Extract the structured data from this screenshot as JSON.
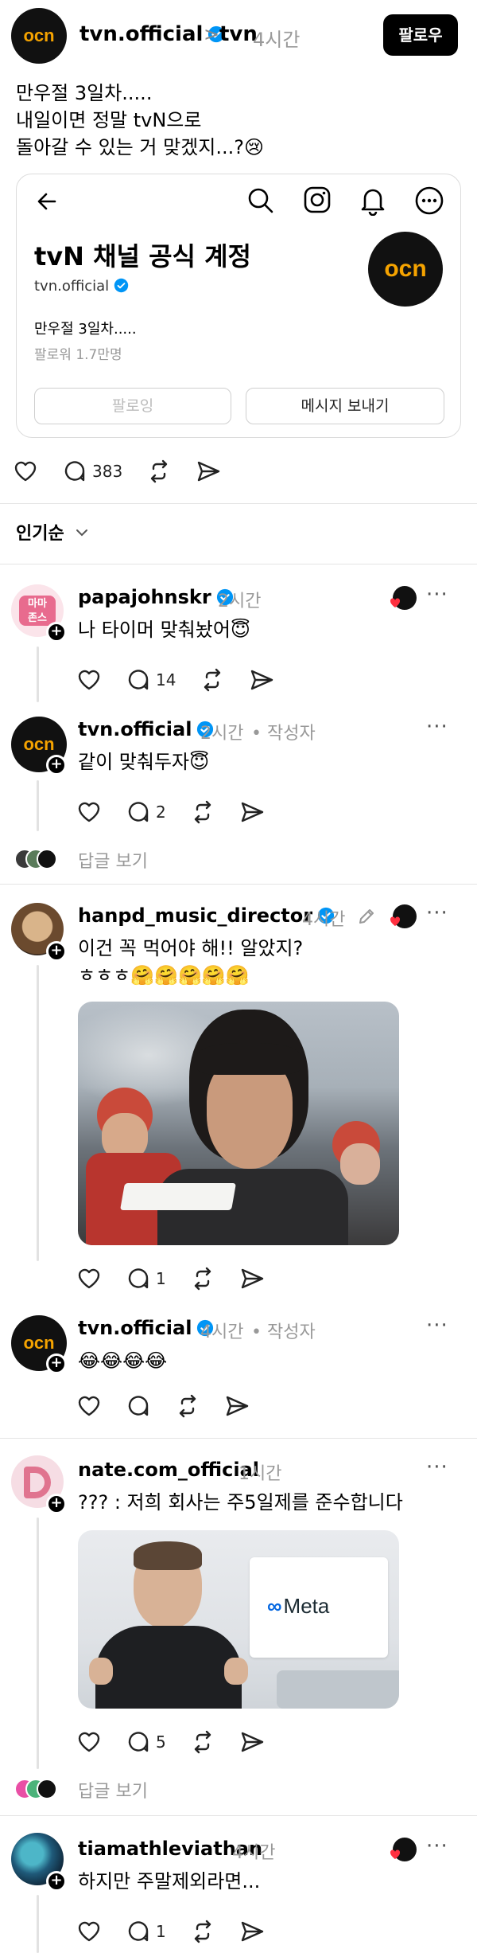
{
  "header": {
    "author": "tvn.official",
    "breadcrumb_separator": ">",
    "channel": "tvn",
    "time": "4시간",
    "follow_label": "팔로우"
  },
  "post": {
    "lines": [
      "만우절 3일차.....",
      "내일이면 정말 tvN으로",
      "돌아갈 수 있는 거 맞겠지...?😢"
    ]
  },
  "embed": {
    "title": "tvN 채널 공식 계정",
    "handle": "tvn.official",
    "bio": "만우절 3일차.....",
    "followers": "팔로워 1.7만명",
    "following_label": "팔로잉",
    "message_label": "메시지 보내기"
  },
  "post_actions": {
    "reply_count": "383"
  },
  "sort": {
    "label": "인기순"
  },
  "logo_text": "ocn",
  "comments": [
    {
      "name": "papajohnskr",
      "time": "2시간",
      "text": "나 타이머 맞춰놨어😇",
      "reply_count": "14"
    },
    {
      "name": "tvn.official",
      "time": "2시간",
      "author_tag": "• 작성자",
      "text": "같이 맞춰두자😇",
      "reply_count": "2"
    },
    {
      "name": "hanpd_music_director",
      "time": "4시간",
      "text": "이건 꼭 먹어야 해!! 알았지?",
      "text2": "ㅎㅎㅎ🤗🤗🤗🤗🤗",
      "reply_count": "1"
    },
    {
      "name": "tvn.official",
      "time": "4시간",
      "author_tag": "• 작성자",
      "text": "😂😂😂😂",
      "reply_count": ""
    },
    {
      "name": "nate.com_official",
      "time": "1시간",
      "text": "??? : 저희 회사는 주5일제를 준수합니다",
      "reply_count": "5"
    },
    {
      "name": "tiamathleviathan",
      "time": "4시간",
      "text": "하지만 주말제외라면...",
      "reply_count": "1"
    }
  ],
  "view_replies_label": "답글 보기",
  "meta_logo": "Meta",
  "colors": {
    "accent": "#0095f6",
    "verified": "#0095f6",
    "ocn_orange": "#f5a300"
  }
}
